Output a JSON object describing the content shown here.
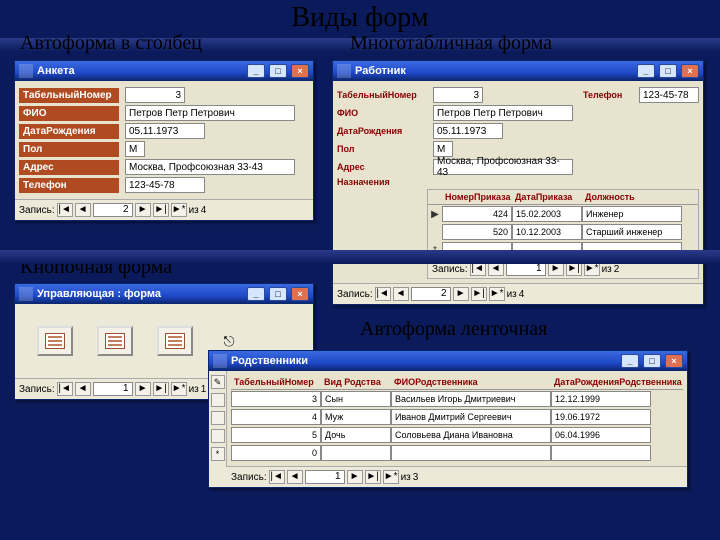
{
  "title": "Виды форм",
  "captions": {
    "columnar": "Автоформа в столбец",
    "multitable": "Многотабличная форма",
    "button": "Кнопочная форма",
    "tabular": "Автоформа ленточная"
  },
  "winctl": {
    "min": "_",
    "max": "□",
    "close": "×"
  },
  "nav": {
    "label": "Запись:",
    "first": "|◄",
    "prev": "◄",
    "next": "►",
    "last": "►|",
    "new": "►*",
    "of": "из"
  },
  "anketa": {
    "title": "Анкета",
    "fields": {
      "tab_no": {
        "label": "ТабельныйНомер",
        "value": "3"
      },
      "fio": {
        "label": "ФИО",
        "value": "Петров Петр Петрович"
      },
      "dob": {
        "label": "ДатаРождения",
        "value": "05.11.1973"
      },
      "pol": {
        "label": "Пол",
        "value": "М"
      },
      "addr": {
        "label": "Адрес",
        "value": "Москва, Профсоюзная 33-43"
      },
      "tel": {
        "label": "Телефон",
        "value": "123-45-78"
      }
    },
    "nav": {
      "current": "2",
      "total": "4"
    }
  },
  "rabotnik": {
    "title": "Работник",
    "fields": {
      "tab_no": {
        "label": "ТабельныйНомер",
        "value": "3"
      },
      "tel": {
        "label": "Телефон",
        "value": "123-45-78"
      },
      "fio": {
        "label": "ФИО",
        "value": "Петров Петр Петрович"
      },
      "dob": {
        "label": "ДатаРождения",
        "value": "05.11.1973"
      },
      "pol": {
        "label": "Пол",
        "value": "М"
      },
      "addr": {
        "label": "Адрес",
        "value": "Москва, Профсоюзная 33-43"
      },
      "nazn": {
        "label": "Назначения"
      }
    },
    "sub": {
      "headers": {
        "num": "НомерПриказа",
        "date": "ДатаПриказа",
        "pos": "Должность"
      },
      "rows": [
        {
          "num": "424",
          "date": "15.02.2003",
          "pos": "Инженер"
        },
        {
          "num": "520",
          "date": "10.12.2003",
          "pos": "Старший инженер"
        }
      ],
      "nav": {
        "current": "1",
        "total": "2"
      }
    },
    "nav": {
      "current": "2",
      "total": "4"
    }
  },
  "uprav": {
    "title": "Управляющая : форма",
    "exit_icon": "⎋",
    "nav": {
      "current": "1",
      "total": "1"
    }
  },
  "rodstv": {
    "title": "Родственники",
    "headers": {
      "tab": "ТабельныйНомер",
      "vid": "Вид Родства",
      "fio": "ФИОРодственника",
      "dob": "ДатаРожденияРодственника"
    },
    "rows": [
      {
        "tab": "3",
        "vid": "Сын",
        "fio": "Васильев Игорь Дмитриевич",
        "dob": "12.12.1999"
      },
      {
        "tab": "4",
        "vid": "Муж",
        "fio": "Иванов Дмитрий Сергеевич",
        "dob": "19.06.1972"
      },
      {
        "tab": "5",
        "vid": "Дочь",
        "fio": "Соловьева Диана Ивановна",
        "dob": "06.04.1996"
      },
      {
        "tab": "0",
        "vid": "",
        "fio": "",
        "dob": ""
      }
    ],
    "nav": {
      "current": "1",
      "total": "3"
    }
  }
}
